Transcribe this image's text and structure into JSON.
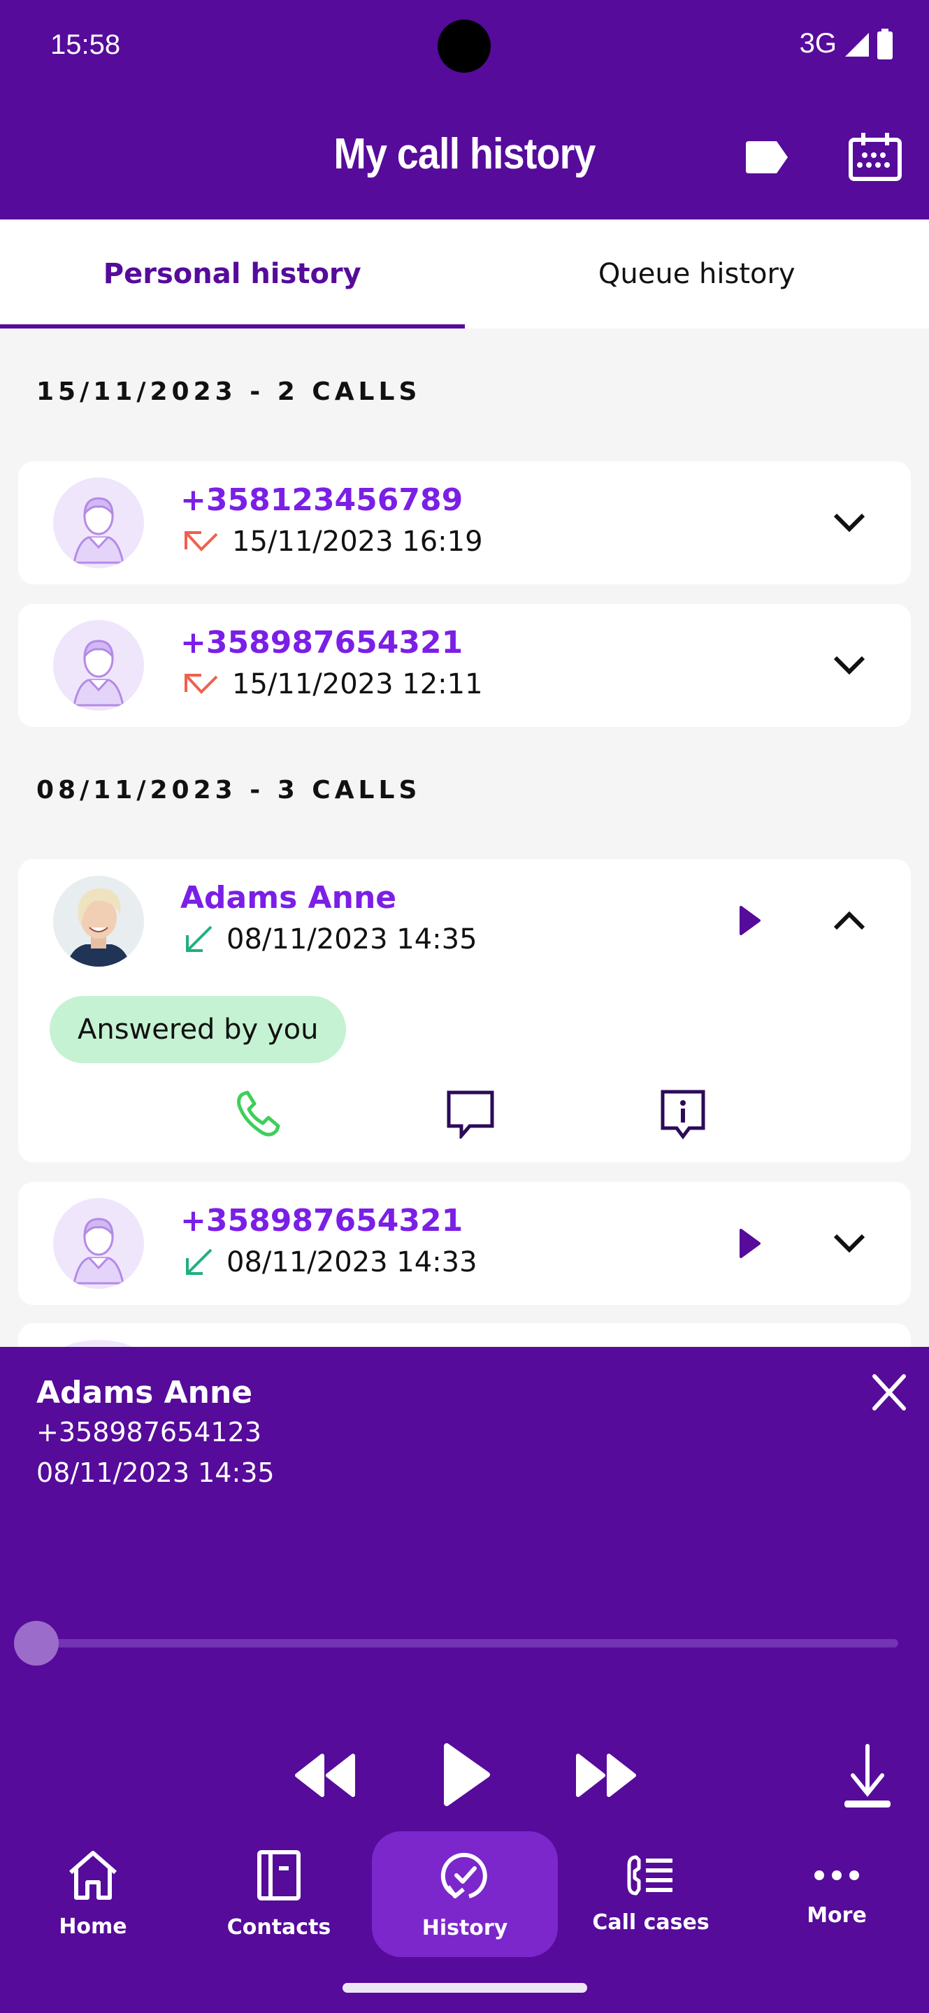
{
  "status_bar": {
    "time": "15:58",
    "network": "3G"
  },
  "header": {
    "title": "My call history",
    "tag_button": "tag-icon",
    "calendar_button": "calendar-icon"
  },
  "tabs": [
    {
      "label": "Personal history",
      "active": true
    },
    {
      "label": "Queue history",
      "active": false
    }
  ],
  "groups": [
    {
      "header": "15/11/2023 - 2 CALLS",
      "calls": [
        {
          "title": "+358123456789",
          "datetime": "15/11/2023 16:19",
          "direction": "missed",
          "avatar": "placeholder",
          "expanded": false,
          "has_recording": false
        },
        {
          "title": "+358987654321",
          "datetime": "15/11/2023 12:11",
          "direction": "missed",
          "avatar": "placeholder",
          "expanded": false,
          "has_recording": false
        }
      ]
    },
    {
      "header": "08/11/2023 - 3 CALLS",
      "calls": [
        {
          "title": "Adams Anne",
          "datetime": "08/11/2023 14:35",
          "direction": "incoming",
          "avatar": "photo",
          "expanded": true,
          "has_recording": true,
          "badge": "Answered by you",
          "actions": [
            "call-icon",
            "message-icon",
            "info-icon"
          ]
        },
        {
          "title": "+358987654321",
          "datetime": "08/11/2023 14:33",
          "direction": "incoming",
          "avatar": "placeholder",
          "expanded": false,
          "has_recording": true
        }
      ]
    }
  ],
  "player": {
    "name": "Adams Anne",
    "number": "+358987654123",
    "datetime": "08/11/2023 14:35",
    "progress": 0,
    "controls": [
      "rewind-icon",
      "play-icon",
      "fast-forward-icon",
      "download-icon"
    ]
  },
  "nav": [
    {
      "label": "Home",
      "icon": "home-icon",
      "active": false
    },
    {
      "label": "Contacts",
      "icon": "contacts-icon",
      "active": false
    },
    {
      "label": "History",
      "icon": "history-icon",
      "active": true
    },
    {
      "label": "Call cases",
      "icon": "call-cases-icon",
      "active": false
    },
    {
      "label": "More",
      "icon": "more-icon",
      "active": false
    }
  ],
  "colors": {
    "brand": "#560b9b",
    "accent_text": "#7b1fe6",
    "missed": "#f0604d",
    "incoming": "#1fb07f",
    "answered_badge": "#c5f2d2",
    "call_action": "#3ecf5a"
  }
}
